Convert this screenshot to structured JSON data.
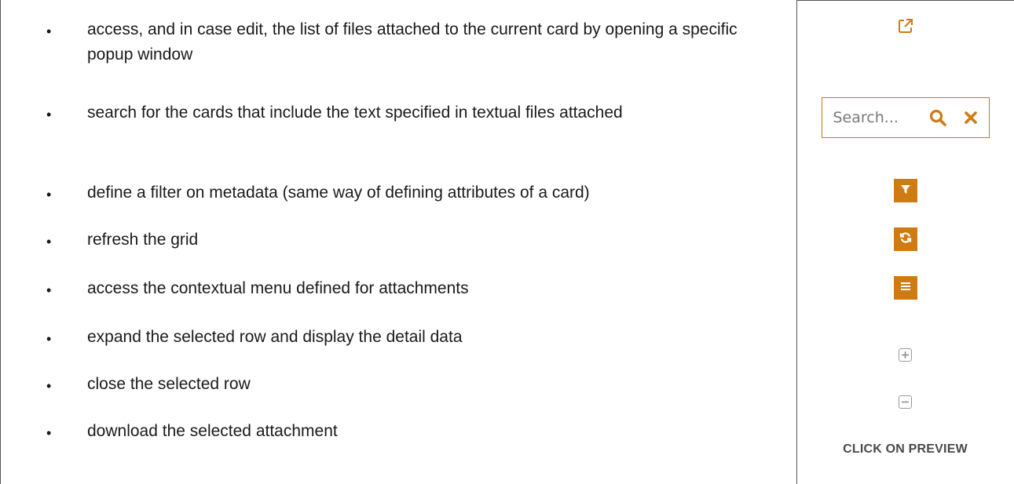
{
  "rows": [
    {
      "bullet": "•",
      "text": "access, and in case edit, the list of files attached to the current card by opening a specific popup window"
    },
    {
      "bullet": "•",
      "text": "search for the cards that include the text specified in textual files attached"
    },
    {
      "bullet": "•",
      "text": "define a filter on metadata (same way of defining attributes of a card)"
    },
    {
      "bullet": "•",
      "text": "refresh the grid"
    },
    {
      "bullet": "•",
      "text": "access the contextual menu defined for attachments"
    },
    {
      "bullet": "•",
      "text": "expand the selected row and display the detail data"
    },
    {
      "bullet": "•",
      "text": "close the selected row"
    },
    {
      "bullet": "•",
      "text": "download the selected attachment"
    }
  ],
  "search": {
    "placeholder": "Search..."
  },
  "preview_label": "CLICK ON PREVIEW",
  "icons": [
    "external-link-icon",
    "search-icon",
    "close-icon",
    "filter-icon",
    "refresh-icon",
    "menu-icon",
    "expand-row-icon",
    "collapse-row-icon"
  ],
  "colors": {
    "accent": "#d07a12",
    "border": "#555555",
    "muted_icon": "#9a9a9a"
  }
}
